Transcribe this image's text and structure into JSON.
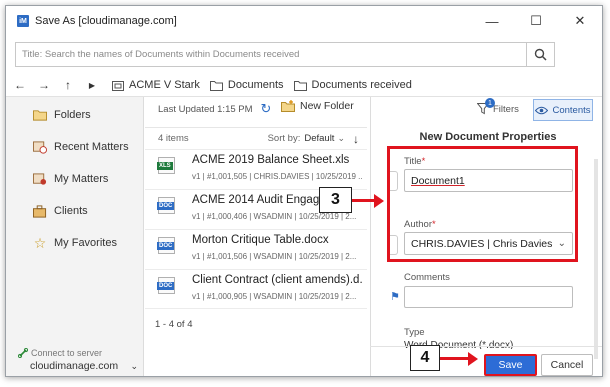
{
  "window": {
    "app_icon": "iM",
    "title": "Save As [cloudimanage.com]",
    "controls": {
      "minimize": "—",
      "maximize": "☐",
      "close": "✕"
    }
  },
  "search": {
    "placeholder": "Title: Search the names of Documents within Documents received"
  },
  "breadcrumb": {
    "items": [
      "ACME V Stark",
      "Documents",
      "Documents received"
    ]
  },
  "sidebar": {
    "items": [
      {
        "label": "Folders",
        "icon": "folder-icon"
      },
      {
        "label": "Recent Matters",
        "icon": "recent-matters-icon"
      },
      {
        "label": "My Matters",
        "icon": "my-matters-icon"
      },
      {
        "label": "Clients",
        "icon": "clients-icon"
      },
      {
        "label": "My Favorites",
        "icon": "star-icon"
      }
    ],
    "connect_label": "Connect to server",
    "server": "cloudimanage.com"
  },
  "list": {
    "last_updated": "Last Updated 1:15 PM",
    "new_folder": "New Folder",
    "count": "4 items",
    "sort_label": "Sort by:",
    "sort_value": "Default",
    "items": [
      {
        "type": "XLS",
        "color": "#1e7a3c",
        "name": "ACME 2019 Balance Sheet.xls",
        "meta": "v1 | #1,001,505 | CHRIS.DAVIES | 10/25/2019 ..."
      },
      {
        "type": "DOC",
        "color": "#2d6cc4",
        "name": "ACME 2014 Audit Engageme",
        "meta": "v1 | #1,000,406 | WSADMIN | 10/25/2019 | 2..."
      },
      {
        "type": "DOC",
        "color": "#2d6cc4",
        "name": "Morton Critique Table.docx",
        "meta": "v1 | #1,001,506 | WSADMIN | 10/25/2019 | 2..."
      },
      {
        "type": "DOC",
        "color": "#2d6cc4",
        "name": "Client Contract (client amends).d...",
        "meta": "v1 | #1,000,905 | WSADMIN | 10/25/2019 | 2..."
      }
    ],
    "pager": "1 - 4 of 4"
  },
  "panel": {
    "filters": "Filters",
    "filters_badge": "1",
    "contents": "Contents",
    "heading": "New Document Properties",
    "title_label": "Title",
    "title_value": "Document1",
    "author_label": "Author",
    "author_value": "CHRIS.DAVIES | Chris Davies",
    "comments_label": "Comments",
    "type_label": "Type",
    "type_value": "Word Document (*.docx)"
  },
  "annotations": {
    "step3": "3",
    "step4": "4",
    "highlight_color": "#e0141e"
  },
  "buttons": {
    "save": "Save",
    "cancel": "Cancel"
  }
}
